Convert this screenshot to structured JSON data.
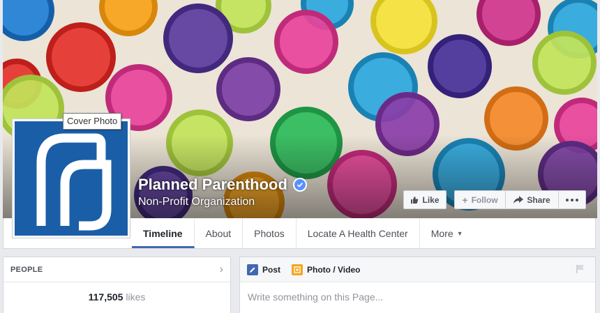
{
  "cover": {
    "tooltip": "Cover Photo"
  },
  "page": {
    "name": "Planned Parenthood",
    "category": "Non-Profit Organization"
  },
  "actions": {
    "like": "Like",
    "follow": "Follow",
    "share": "Share"
  },
  "nav": {
    "tabs": [
      "Timeline",
      "About",
      "Photos",
      "Locate A Health Center",
      "More"
    ]
  },
  "people": {
    "title": "PEOPLE",
    "likes_count": "117,505",
    "likes_label": "likes"
  },
  "composer": {
    "post_label": "Post",
    "photo_label": "Photo / Video",
    "placeholder": "Write something on this Page..."
  },
  "colors": {
    "brand": "#1a5ea7",
    "accent": "#4267b2",
    "page_bg": "#e9eaed"
  }
}
